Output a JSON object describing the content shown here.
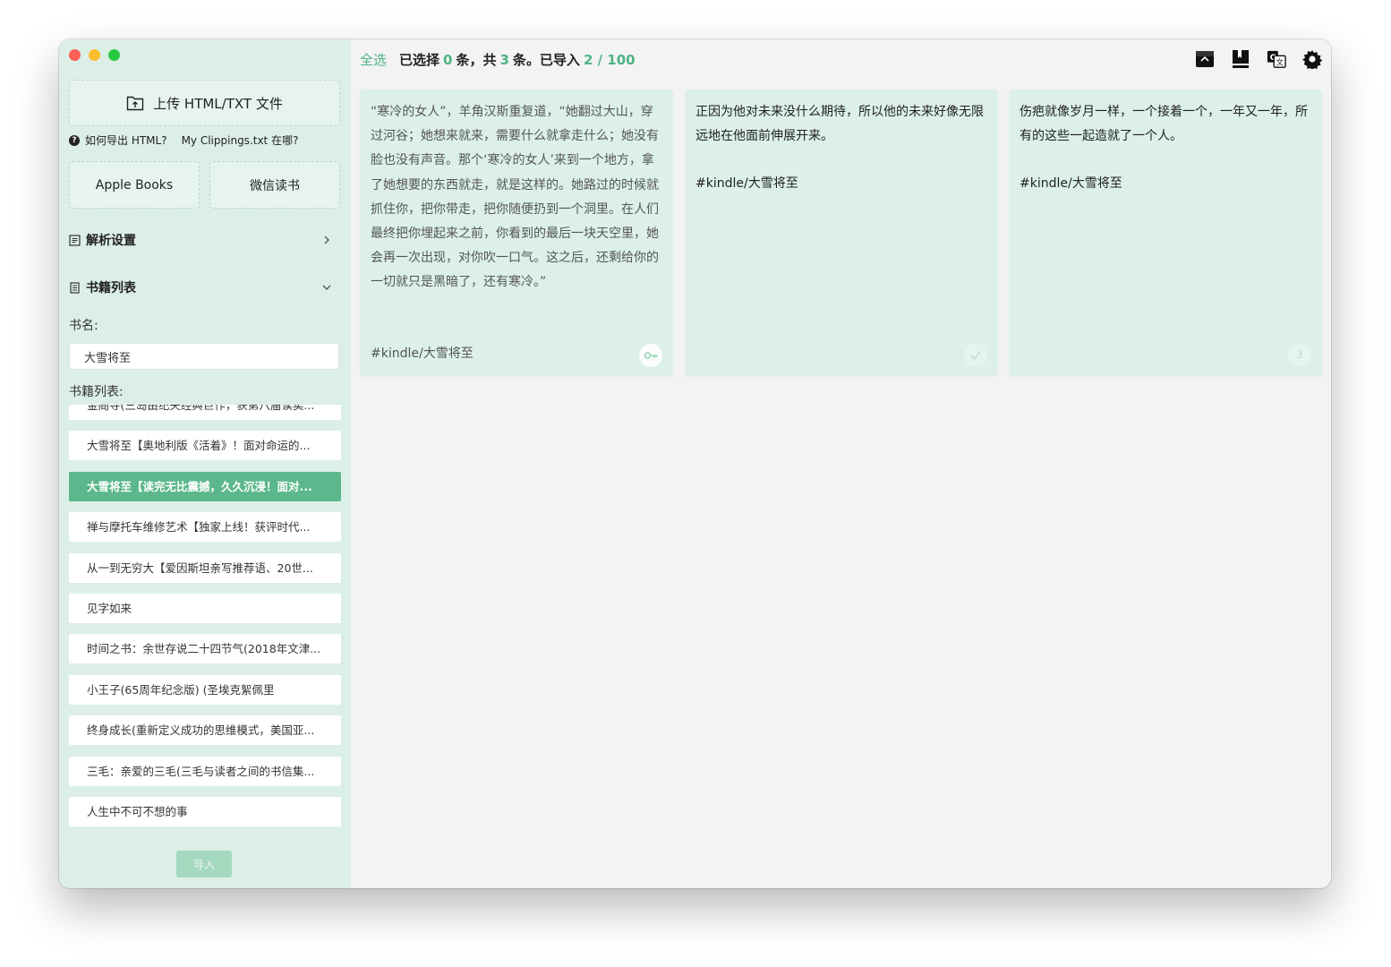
{
  "sidebar": {
    "upload_label": "上传 HTML/TXT 文件",
    "help_html": "如何导出 HTML?",
    "help_clippings": "My Clippings.txt 在哪?",
    "apple_books": "Apple Books",
    "wechat_read": "微信读书",
    "parse_settings": "解析设置",
    "book_list_section": "书籍列表",
    "book_name_label": "书名:",
    "book_name_value": "大雪将至",
    "book_list_label": "书籍列表:",
    "books": [
      "金阁寺(三岛由纪夫经典巨作，获第八届读卖...",
      "大雪将至【奥地利版《活着》！面对命运的...",
      "大雪将至【读完无比震撼，久久沉浸！面对...",
      "禅与摩托车维修艺术【独家上线！获评时代...",
      "从一到无穷大【爱因斯坦亲写推荐语、20世...",
      "见字如来",
      "时间之书：余世存说二十四节气(2018年文津...",
      "小王子(65周年纪念版) (圣埃克絮佩里",
      "终身成长(重新定义成功的思维模式，美国亚...",
      "三毛：亲爱的三毛(三毛与读者之间的书信集...",
      "人生中不可不想的事"
    ],
    "selected_index": 2,
    "import_button": "导入"
  },
  "topbar": {
    "select_all": "全选",
    "selected_prefix": "已选择",
    "selected_count": "0",
    "total_prefix": "条，共",
    "total_count": "3",
    "imported_prefix": "条。已导入",
    "imported_value": "2 / 100"
  },
  "toolbar_icons": [
    "archive-icon",
    "book-icon",
    "translate-icon",
    "gear-icon"
  ],
  "cards": [
    {
      "text": "“寒冷的女人”，羊角汉斯重复道，“她翻过大山，穿过河谷；她想来就来，需要什么就拿走什么；她没有脸也没有声音。那个‘寒冷的女人’来到一个地方，拿了她想要的东西就走，就是这样的。她路过的时候就抓住你，把你带走，把你随便扔到一个洞里。在人们最终把你埋起来之前，你看到的最后一块天空里，她会再一次出现，对你吹一口气。这之后，还剩给你的一切就只是黑暗了，还有寒冷。”",
      "tag": "#kindle/大雪将至",
      "badge": "key-icon"
    },
    {
      "text": "正因为他对未来没什么期待，所以他的未来好像无限远地在他面前伸展开来。",
      "tag": "#kindle/大雪将至",
      "badge": "check-icon"
    },
    {
      "text": "伤疤就像岁月一样，一个接着一个，一年又一年，所有的这些一起造就了一个人。",
      "tag": "#kindle/大雪将至",
      "badge_text": "3"
    }
  ],
  "colors": {
    "accent": "#4fb384",
    "sidebar_bg": "#dcefe6",
    "card_bg": "#dcf0e7",
    "selected_item": "#5cb88c"
  }
}
